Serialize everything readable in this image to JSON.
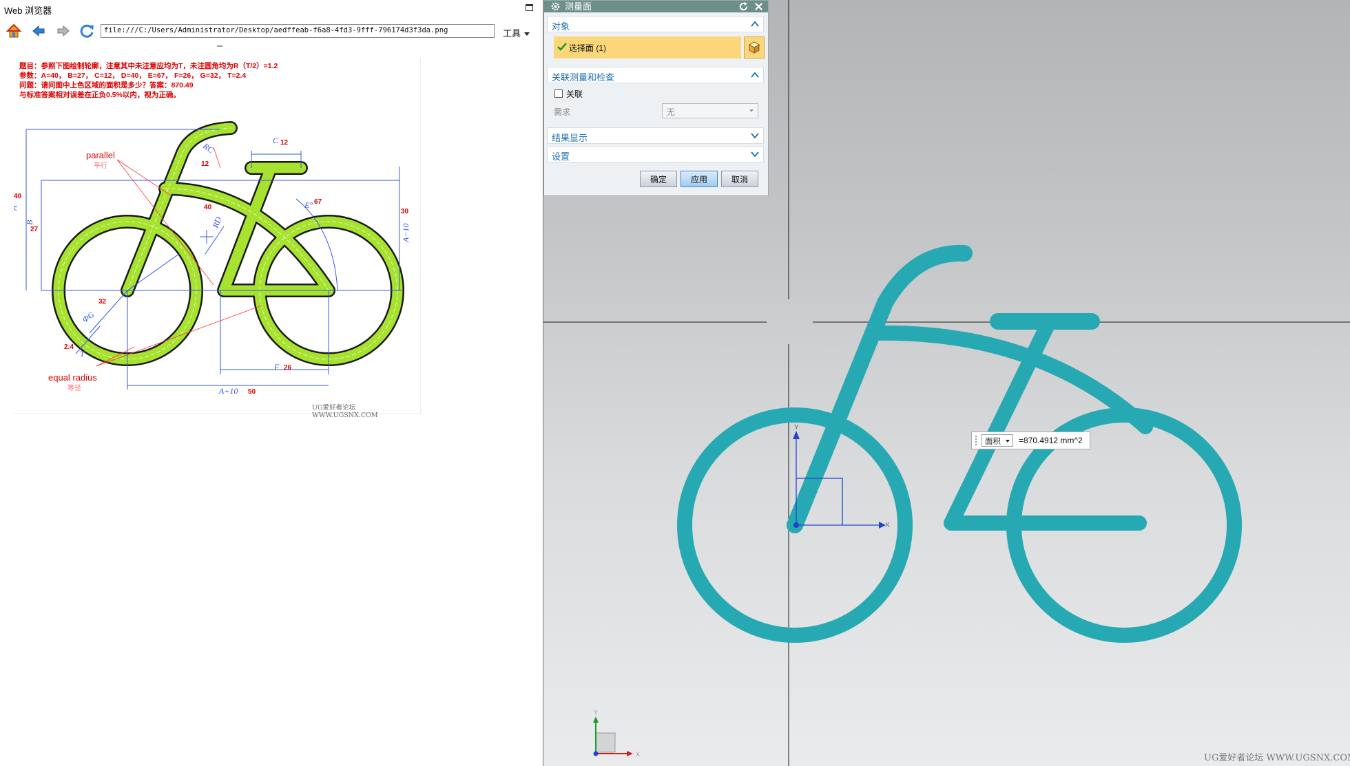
{
  "browser": {
    "title": "Web 浏览器",
    "url": "file:///C:/Users/Administrator/Desktop/aedffeab-f6a8-4fd3-9fff-796174d3f3da.png",
    "tools_label": "工具",
    "icons": [
      "home-icon",
      "back-arrow-icon",
      "forward-arrow-icon",
      "refresh-icon"
    ]
  },
  "problem": {
    "lines": [
      "题目：参照下图绘制轮廓，注意其中未注意应均为T，未注圆角均为R（T/2）=1.2",
      "参数：A=40， B=27， C=12， D=40， E=67， F=26， G=32， T=2.4",
      "问题：请问图中上色区域的面积是多少？答案：870.49",
      "与标准答案相对误差在正负0.5%以内，视为正确。"
    ],
    "dim_labels": {
      "A": "A",
      "A_val": "40",
      "B": "B",
      "B_val": "27",
      "C": "C",
      "C_val": "12",
      "RC": "RC",
      "RC_val": "12",
      "RD": "RD",
      "RD_val": "40",
      "E": "E°",
      "E_val": "67",
      "A10": "A−10",
      "A10_val": "30",
      "G": "ΦG",
      "G_val": "32",
      "T": "T",
      "T_val": "2.4",
      "F": "F",
      "F_val": "26",
      "A_plus_10": "A+10",
      "A_plus_10_val": "50"
    },
    "annotations": {
      "parallel": "parallel",
      "parallel_cn": "平行",
      "equal_radius": "equal radius",
      "equal_radius_cn": "等径"
    },
    "footer": "UG爱好者论坛 WWW.UGSNX.COM",
    "fill_color": "#a6e22e"
  },
  "dialog": {
    "title": "测量面",
    "section_object": "对象",
    "select_face": "选择面 (1)",
    "section_assoc": "关联测量和检查",
    "assoc_label": "关联",
    "requirement_label": "需求",
    "requirement_value": "无",
    "section_results": "结果显示",
    "section_settings": "设置",
    "ok": "确定",
    "apply": "应用",
    "cancel": "取消"
  },
  "viewport": {
    "measure_type": "面积",
    "measure_value": "=870.4912 mm^2",
    "axis_x": "X",
    "axis_y": "Y",
    "watermark": "UG爱好者论坛 WWW.UGSNX.COM",
    "bike_color": "#27a9b3"
  }
}
